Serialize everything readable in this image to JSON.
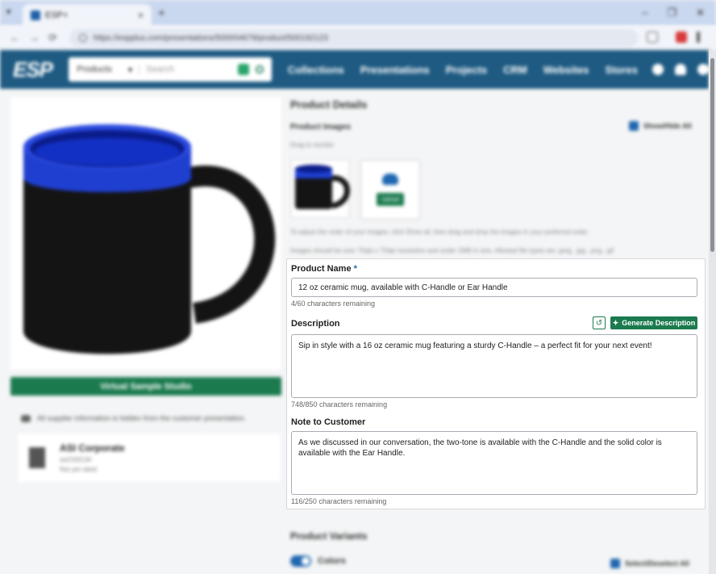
{
  "browser": {
    "tab_title": "ESP+",
    "tab_close": "×",
    "new_tab": "+",
    "url": "https://espplus.com/presentations/500004679/product/500192123",
    "back": "←",
    "forward": "→",
    "reload": "⟳",
    "win_min": "–",
    "win_max": "❐",
    "win_close": "✕"
  },
  "app": {
    "logo": "ESP",
    "search_type": "Products",
    "search_type_caret": "▾",
    "search_placeholder": "Search",
    "nav": [
      "Collections",
      "Presentations",
      "Projects",
      "CRM",
      "Websites",
      "Stores"
    ]
  },
  "left": {
    "virtual_sample_button": "Virtual Sample Studio",
    "supplier_hidden_note": "All supplier information is hidden from the customer presentation.",
    "supplier": {
      "name": "ASI Corporate",
      "id": "asi/100134",
      "rating": "Not yet rated"
    }
  },
  "details": {
    "title": "Product Details",
    "images_label": "Product Images",
    "show_hide_all": "Show/Hide All",
    "drag_hint": "Drag to reorder",
    "upload_label": "Upload",
    "hint1": "To adjust the order of your images, click Show all, then drag and drop the images in your preferred order.",
    "hint2": "Images should be over 75dpi x 75dpi resolution and under 2MB in size. Allowed file types are .jpeg, .jpg, .png, .gif"
  },
  "form": {
    "product_name_label": "Product Name",
    "required_mark": "*",
    "product_name_value": "12 oz ceramic mug, available with C-Handle or Ear Handle",
    "product_name_count": "4/60 characters remaining",
    "description_label": "Description",
    "regen_icon": "↺",
    "generate_label": "Generate Description",
    "generate_icon": "✦",
    "description_value": "Sip in style with a 16 oz ceramic mug featuring a sturdy C-Handle – a perfect fit for your next event!",
    "description_count": "748/850 characters remaining",
    "note_label": "Note to Customer",
    "note_value": "As we discussed in our conversation, the two-tone is available with the C-Handle and the solid color is available with the Ear Handle.",
    "note_count": "116/250 characters remaining"
  },
  "variants": {
    "title": "Product Variants",
    "colors_label": "Colors",
    "select_all": "Select/Deselect All"
  },
  "colors": {
    "header_bg": "#1e5a82",
    "accent_green": "#1b7a4e",
    "mug_blue": "#1f3fd1",
    "mug_black": "#141414"
  }
}
